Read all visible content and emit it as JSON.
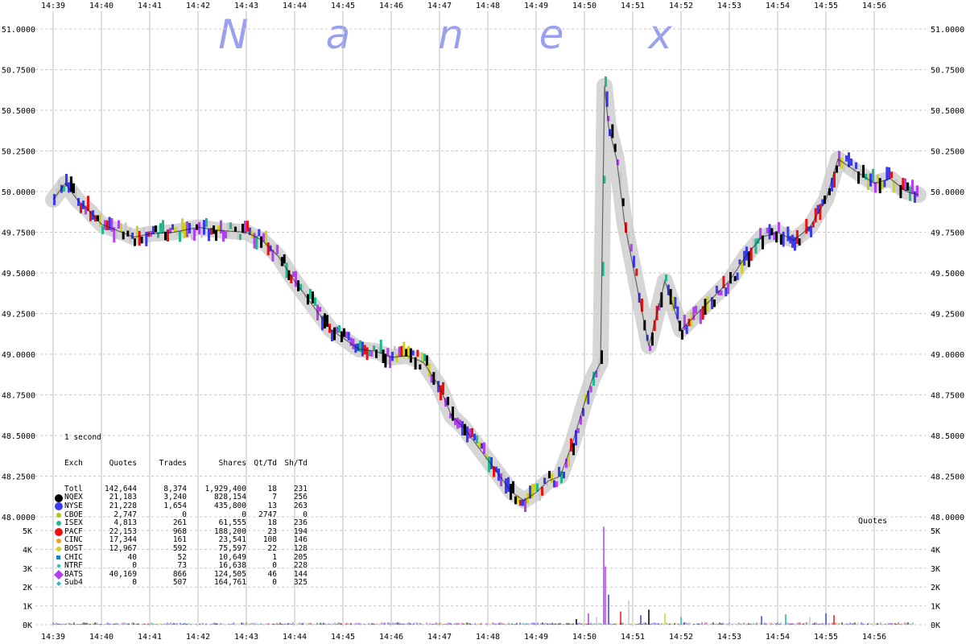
{
  "watermark": [
    "N",
    "a",
    "n",
    "e",
    "x"
  ],
  "time_ticks": [
    "14:39",
    "14:40",
    "14:41",
    "14:42",
    "14:43",
    "14:44",
    "14:45",
    "14:46",
    "14:47",
    "14:48",
    "14:49",
    "14:50",
    "14:51",
    "14:52",
    "14:53",
    "14:54",
    "14:55",
    "14:56"
  ],
  "price_ticks": [
    "51.0000",
    "50.7500",
    "50.5000",
    "50.2500",
    "50.0000",
    "49.7500",
    "49.5000",
    "49.2500",
    "49.0000",
    "48.7500",
    "48.5000",
    "48.2500",
    "48.0000"
  ],
  "volume_ticks": [
    "5K",
    "4K",
    "3K",
    "2K",
    "1K",
    "0K"
  ],
  "volume_label": "Quotes",
  "stats": {
    "interval": "1 second",
    "headers": [
      "Exch",
      "Quotes",
      "Trades",
      "Shares",
      "Qt/Td",
      "Sh/Td"
    ],
    "rows": [
      {
        "exch": "Totl",
        "quotes": "142,644",
        "trades": "8,374",
        "shares": "1,929,400",
        "qt_td": "18",
        "sh_td": "231",
        "color": "",
        "marker": "none"
      },
      {
        "exch": "NQEX",
        "quotes": "21,183",
        "trades": "3,240",
        "shares": "828,154",
        "qt_td": "7",
        "sh_td": "256",
        "color": "#000000",
        "marker": "circle-lg"
      },
      {
        "exch": "NYSE",
        "quotes": "21,228",
        "trades": "1,654",
        "shares": "435,800",
        "qt_td": "13",
        "sh_td": "263",
        "color": "#3a3af0",
        "marker": "circle-lg"
      },
      {
        "exch": "CBOE",
        "quotes": "2,747",
        "trades": "0",
        "shares": "0",
        "qt_td": "2747",
        "sh_td": "0",
        "color": "#a8c820",
        "marker": "circle-sm"
      },
      {
        "exch": "ISEX",
        "quotes": "4,813",
        "trades": "261",
        "shares": "61,555",
        "qt_td": "18",
        "sh_td": "236",
        "color": "#20b890",
        "marker": "circle-sm"
      },
      {
        "exch": "PACF",
        "quotes": "22,153",
        "trades": "968",
        "shares": "188,200",
        "qt_td": "23",
        "sh_td": "194",
        "color": "#ee1010",
        "marker": "circle-lg"
      },
      {
        "exch": "CINC",
        "quotes": "17,344",
        "trades": "161",
        "shares": "23,541",
        "qt_td": "108",
        "sh_td": "146",
        "color": "#f0a020",
        "marker": "circle-sm"
      },
      {
        "exch": "BOST",
        "quotes": "12,967",
        "trades": "592",
        "shares": "75,597",
        "qt_td": "22",
        "sh_td": "128",
        "color": "#d0d020",
        "marker": "circle-sm"
      },
      {
        "exch": "CHIC",
        "quotes": "40",
        "trades": "52",
        "shares": "10,649",
        "qt_td": "1",
        "sh_td": "205",
        "color": "#2080c0",
        "marker": "square-sm"
      },
      {
        "exch": "NTRF",
        "quotes": "0",
        "trades": "73",
        "shares": "16,638",
        "qt_td": "0",
        "sh_td": "228",
        "color": "#20c0b0",
        "marker": "circle-xs"
      },
      {
        "exch": "BATS",
        "quotes": "40,169",
        "trades": "866",
        "shares": "124,505",
        "qt_td": "46",
        "sh_td": "144",
        "color": "#b040f0",
        "marker": "diamond"
      },
      {
        "exch": "Sub4",
        "quotes": "0",
        "trades": "507",
        "shares": "164,761",
        "qt_td": "0",
        "sh_td": "325",
        "color": "#30b8d0",
        "marker": "diamond-sm"
      }
    ]
  },
  "chart_data": {
    "type": "line",
    "x_unit": "time (HH:MM)",
    "price_range": [
      48.0,
      51.0
    ],
    "volume_range": [
      0,
      5000
    ],
    "price_path": [
      [
        "14:39:00",
        49.95
      ],
      [
        "14:39:15",
        50.05
      ],
      [
        "14:39:30",
        49.95
      ],
      [
        "14:39:45",
        49.88
      ],
      [
        "14:40:00",
        49.8
      ],
      [
        "14:40:20",
        49.76
      ],
      [
        "14:40:40",
        49.72
      ],
      [
        "14:41:00",
        49.74
      ],
      [
        "14:41:30",
        49.75
      ],
      [
        "14:42:00",
        49.78
      ],
      [
        "14:42:30",
        49.76
      ],
      [
        "14:43:00",
        49.75
      ],
      [
        "14:43:20",
        49.7
      ],
      [
        "14:43:40",
        49.6
      ],
      [
        "14:44:00",
        49.45
      ],
      [
        "14:44:15",
        49.35
      ],
      [
        "14:44:30",
        49.25
      ],
      [
        "14:44:45",
        49.15
      ],
      [
        "14:45:00",
        49.1
      ],
      [
        "14:45:20",
        49.03
      ],
      [
        "14:45:40",
        49.02
      ],
      [
        "14:46:00",
        48.98
      ],
      [
        "14:46:20",
        48.99
      ],
      [
        "14:46:40",
        48.95
      ],
      [
        "14:47:00",
        48.8
      ],
      [
        "14:47:15",
        48.62
      ],
      [
        "14:47:30",
        48.55
      ],
      [
        "14:47:45",
        48.45
      ],
      [
        "14:48:00",
        48.35
      ],
      [
        "14:48:15",
        48.25
      ],
      [
        "14:48:30",
        48.15
      ],
      [
        "14:48:45",
        48.1
      ],
      [
        "14:49:00",
        48.15
      ],
      [
        "14:49:15",
        48.22
      ],
      [
        "14:49:30",
        48.25
      ],
      [
        "14:49:45",
        48.45
      ],
      [
        "14:50:00",
        48.7
      ],
      [
        "14:50:10",
        48.85
      ],
      [
        "14:50:20",
        48.95
      ],
      [
        "14:50:25",
        50.65
      ],
      [
        "14:50:30",
        50.4
      ],
      [
        "14:50:40",
        50.2
      ],
      [
        "14:50:50",
        49.8
      ],
      [
        "14:51:00",
        49.55
      ],
      [
        "14:51:10",
        49.3
      ],
      [
        "14:51:20",
        49.05
      ],
      [
        "14:51:40",
        49.45
      ],
      [
        "14:52:00",
        49.15
      ],
      [
        "14:52:20",
        49.25
      ],
      [
        "14:52:40",
        49.35
      ],
      [
        "14:53:00",
        49.45
      ],
      [
        "14:53:20",
        49.6
      ],
      [
        "14:53:40",
        49.72
      ],
      [
        "14:54:00",
        49.75
      ],
      [
        "14:54:20",
        49.7
      ],
      [
        "14:54:40",
        49.78
      ],
      [
        "14:55:00",
        49.95
      ],
      [
        "14:55:15",
        50.2
      ],
      [
        "14:55:30",
        50.15
      ],
      [
        "14:55:45",
        50.1
      ],
      [
        "14:56:00",
        50.05
      ],
      [
        "14:56:20",
        50.08
      ],
      [
        "14:56:40",
        50.0
      ],
      [
        "14:56:55",
        49.98
      ]
    ],
    "volume_spikes": [
      [
        "14:49:50",
        300
      ],
      [
        "14:50:05",
        600
      ],
      [
        "14:50:15",
        400
      ],
      [
        "14:50:24",
        5200
      ],
      [
        "14:50:26",
        3100
      ],
      [
        "14:50:30",
        1600
      ],
      [
        "14:50:45",
        700
      ],
      [
        "14:50:55",
        1300
      ],
      [
        "14:51:10",
        500
      ],
      [
        "14:51:20",
        800
      ],
      [
        "14:51:40",
        600
      ],
      [
        "14:52:00",
        400
      ],
      [
        "14:53:40",
        450
      ],
      [
        "14:54:10",
        550
      ],
      [
        "14:54:40",
        400
      ],
      [
        "14:55:00",
        600
      ],
      [
        "14:55:10",
        500
      ]
    ]
  }
}
